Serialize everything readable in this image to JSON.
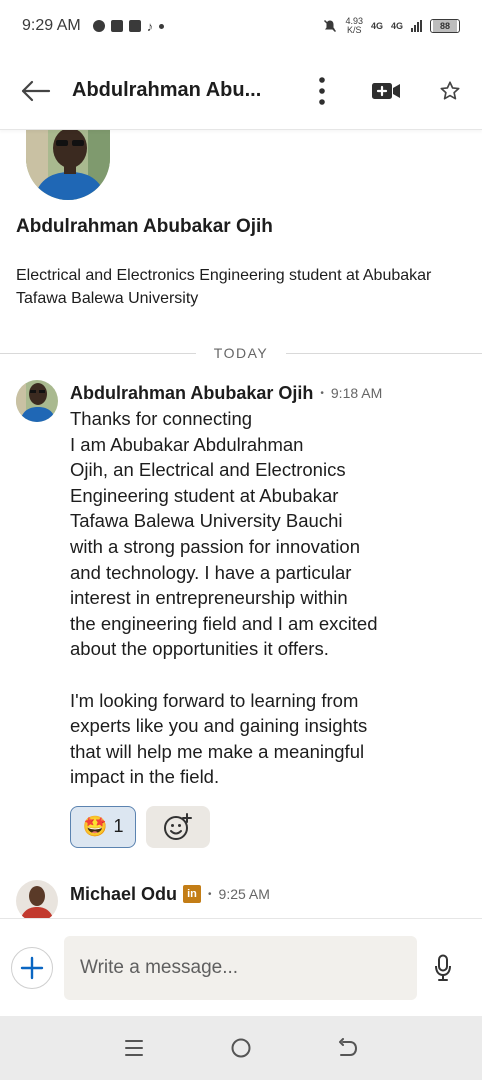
{
  "status_bar": {
    "time": "9:29 AM",
    "speed_value": "4.93",
    "speed_unit": "K/S",
    "network_1": "4G",
    "network_2": "4G",
    "battery": "88"
  },
  "header": {
    "title": "Abdulrahman Abu...",
    "back_icon": "arrow-left-icon",
    "menu_icon": "more-vertical-icon",
    "video_icon": "video-call-icon",
    "star_icon": "star-outline-icon"
  },
  "profile": {
    "name": "Abdulrahman Abubakar Ojih",
    "headline": "Electrical and Electronics Engineering student at Abubakar Tafawa Balewa University"
  },
  "date_divider": "TODAY",
  "messages": [
    {
      "sender": "Abdulrahman Abubakar Ojih",
      "time": "9:18 AM",
      "text": "Thanks for connecting\nI am Abubakar Abdulrahman\nOjih, an Electrical and Electronics\nEngineering student at Abubakar\nTafawa Balewa University Bauchi\nwith a strong passion for innovation\nand technology. I have a particular\ninterest in entrepreneurship within\nthe engineering field and I am excited\nabout the opportunities it offers.\n\nI'm looking forward to learning from\nexperts like you and gaining insights\nthat will help me make a meaningful\nimpact in the field.",
      "reaction": {
        "emoji": "🤩",
        "count": "1"
      }
    },
    {
      "sender": "Michael Odu",
      "badge": "in",
      "time": "9:25 AM"
    }
  ],
  "composer": {
    "placeholder": "Write a message..."
  },
  "nav": {
    "recents_icon": "menu-lines-icon",
    "home_icon": "circle-home-icon",
    "back_icon": "back-arrow-icon"
  },
  "colors": {
    "accent_blue": "#0a66c2",
    "reaction_bg": "#dce6f1",
    "input_bg": "#f2f0ec",
    "linkedin_badge": "#c37d16"
  }
}
